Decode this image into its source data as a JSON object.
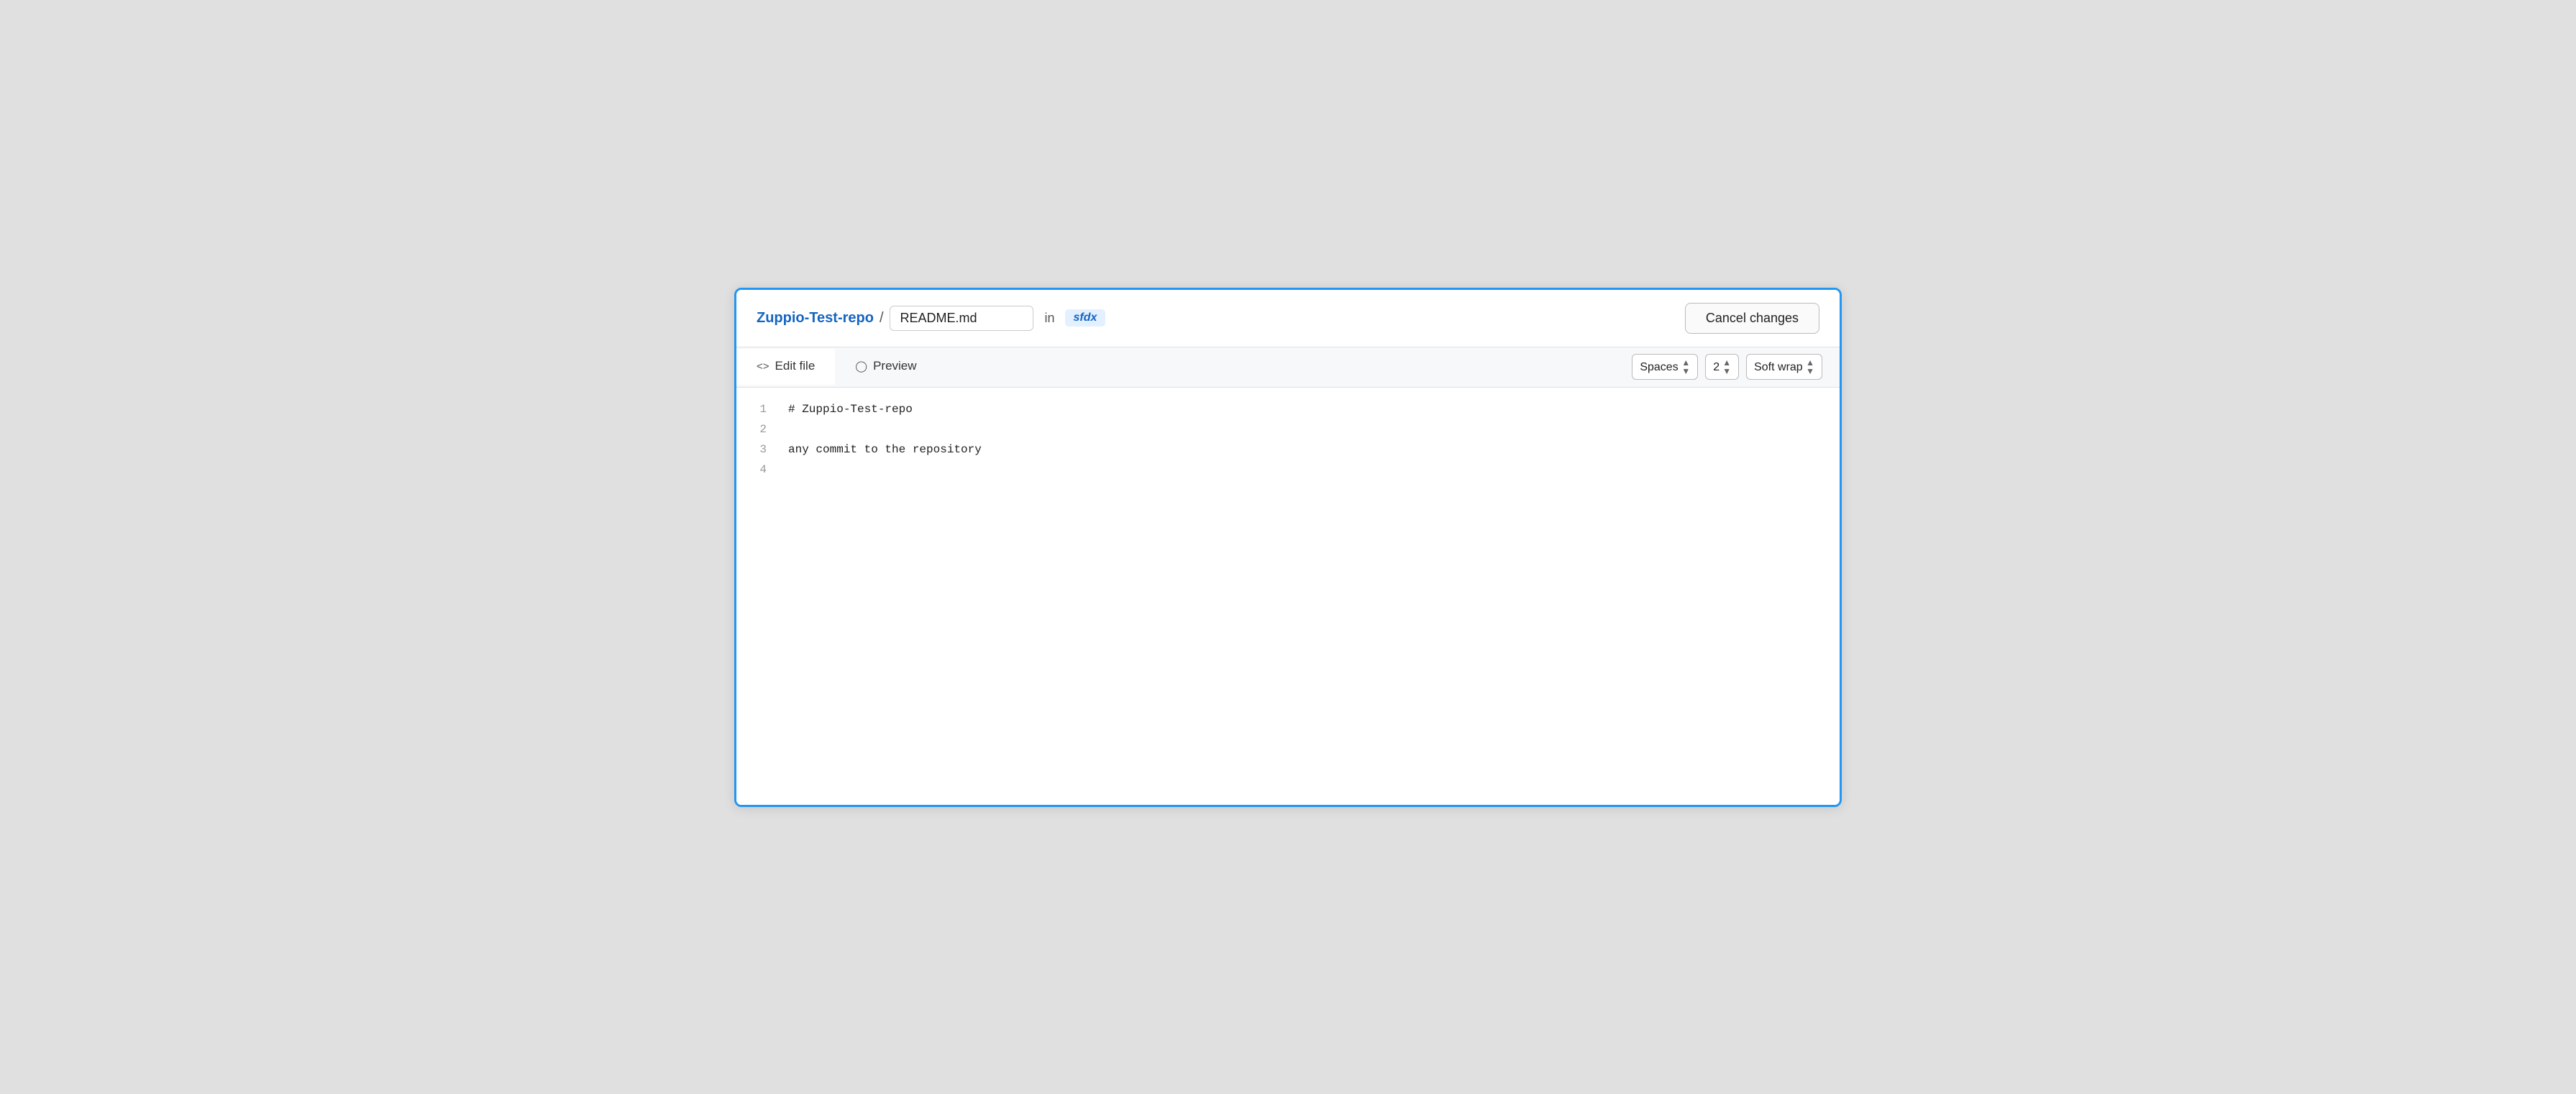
{
  "header": {
    "repo_name": "Zuppio-Test-repo",
    "separator": "/",
    "filename": "README.md",
    "in_label": "in",
    "branch": "sfdx",
    "cancel_label": "Cancel changes"
  },
  "editor_toolbar": {
    "edit_tab_label": "Edit file",
    "edit_tab_icon": "◇>",
    "preview_tab_label": "Preview",
    "preview_tab_icon": "◉",
    "spaces_label": "Spaces",
    "indent_value": "2",
    "wrap_label": "Soft wrap"
  },
  "editor": {
    "lines": [
      {
        "number": "1",
        "content": "# Zuppio-Test-repo"
      },
      {
        "number": "2",
        "content": ""
      },
      {
        "number": "3",
        "content": "any commit to the repository"
      },
      {
        "number": "4",
        "content": ""
      }
    ]
  }
}
